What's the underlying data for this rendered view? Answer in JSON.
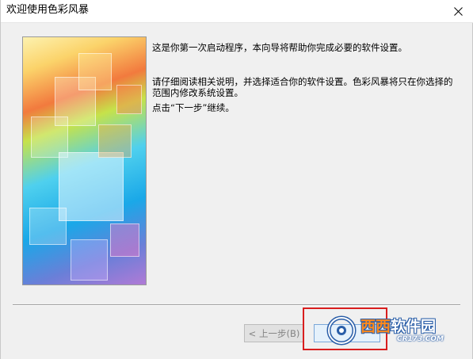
{
  "window": {
    "title": "欢迎使用色彩风暴"
  },
  "content": {
    "paragraph1": "这是你第一次启动程序，本向导将帮助你完成必要的软件设置。",
    "paragraph2": "请仔细阅读相关说明，并选择适合你的软件设置。色彩风暴将只在你选择的范围内修改系统设置。",
    "paragraph3": "点击“下一步”继续。"
  },
  "buttons": {
    "back_label": "< 上一步(B)",
    "next_label": ""
  },
  "watermark": {
    "main_orange": "西西",
    "main_white": "软件园",
    "url": "CR173.COM"
  },
  "colors": {
    "highlight": "#d81e1e",
    "background": "#f0f0f0",
    "watermark_blue": "#2a5ea8",
    "watermark_orange": "#ff8a1c"
  },
  "icons": {
    "close": "close-icon",
    "watermark_logo": "cr173-logo-icon"
  }
}
